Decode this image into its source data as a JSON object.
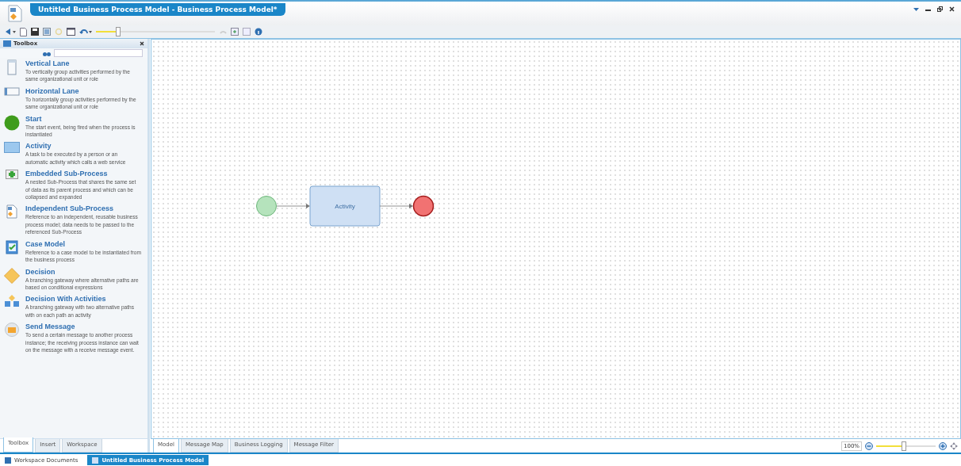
{
  "window": {
    "title": "Untitled Business Process Model - Business Process Model*"
  },
  "toolbar": {
    "history_slider": {
      "level": 0.18
    }
  },
  "toolbox": {
    "title": "Toolbox",
    "items": [
      {
        "kind": "vlane",
        "title": "Vertical Lane",
        "description": "To vertically group activities performed by the same organizational unit or role"
      },
      {
        "kind": "hlane",
        "title": "Horizontal Lane",
        "description": "To horizontally group activities performed by the same organizational unit or role"
      },
      {
        "kind": "start",
        "title": "Start",
        "description": "The start event, being fired when the process is instantiated"
      },
      {
        "kind": "activity",
        "title": "Activity",
        "description": "A task to be executed by a person or an automatic activity which calls a web service"
      },
      {
        "kind": "embedded",
        "title": "Embedded Sub-Process",
        "description": "A nested Sub-Process that shares the same set of data as its parent process and which can be collapsed and expanded"
      },
      {
        "kind": "independent",
        "title": "Independent Sub-Process",
        "description": "Reference to an independent, reusable business process model; data needs to be passed to the referenced Sub-Process"
      },
      {
        "kind": "case",
        "title": "Case Model",
        "description": "Reference to a case model to be instantiated from the business process"
      },
      {
        "kind": "decision",
        "title": "Decision",
        "description": "A branching gateway where alternative paths are based on conditional expressions"
      },
      {
        "kind": "decision_activities",
        "title": "Decision With Activities",
        "description": "A branching gateway with two alternative paths with on each path an activity"
      },
      {
        "kind": "message",
        "title": "Send Message",
        "description": "To send a certain message to another process instance; the receiving process instance can wait on the message with a receive message event."
      }
    ]
  },
  "panel_tabs": [
    {
      "label": "Toolbox",
      "selected": true
    },
    {
      "label": "Insert",
      "selected": false
    },
    {
      "label": "Workspace",
      "selected": false
    }
  ],
  "diagram": {
    "nodes": [
      {
        "kind": "start"
      },
      {
        "kind": "activity",
        "label": "Activity"
      },
      {
        "kind": "end"
      }
    ]
  },
  "model_tabs": [
    {
      "label": "Model",
      "selected": true
    },
    {
      "label": "Message Map",
      "selected": false
    },
    {
      "label": "Business Logging",
      "selected": false
    },
    {
      "label": "Message Filter",
      "selected": false
    }
  ],
  "zoom": {
    "value": "100%",
    "level": 0.45
  },
  "taskbar": [
    {
      "label": "Workspace Documents",
      "selected": false
    },
    {
      "label": "Untitled Business Process Model",
      "selected": true
    }
  ]
}
